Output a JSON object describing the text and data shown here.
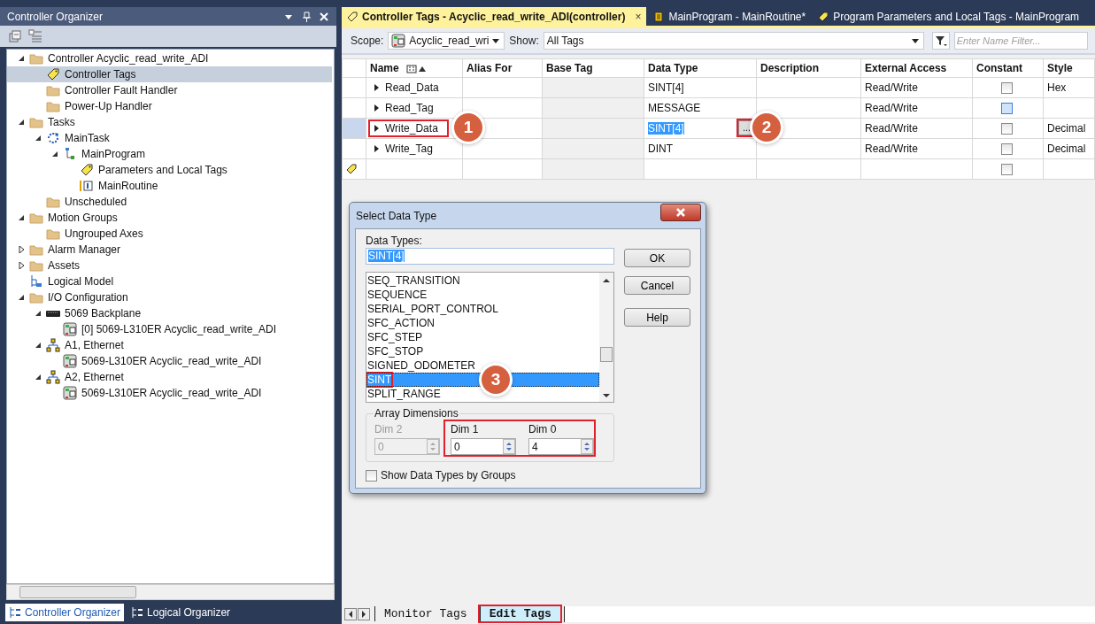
{
  "organizer": {
    "title": "Controller Organizer",
    "tree": [
      {
        "label": "Controller Acyclic_read_write_ADI",
        "kind": "folder",
        "expanded": true,
        "selected": false,
        "children": [
          {
            "label": "Controller Tags",
            "kind": "tags",
            "selected": true
          },
          {
            "label": "Controller Fault Handler",
            "kind": "folder",
            "selected": false
          },
          {
            "label": "Power-Up Handler",
            "kind": "folder",
            "selected": false
          }
        ]
      },
      {
        "label": "Tasks",
        "kind": "folder",
        "expanded": true,
        "selected": false,
        "children": [
          {
            "label": "MainTask",
            "kind": "task",
            "expanded": true,
            "selected": false,
            "children": [
              {
                "label": "MainProgram",
                "kind": "program",
                "expanded": true,
                "selected": false,
                "children": [
                  {
                    "label": "Parameters and Local Tags",
                    "kind": "tags",
                    "selected": false
                  },
                  {
                    "label": "MainRoutine",
                    "kind": "routine",
                    "selected": false
                  }
                ]
              }
            ]
          },
          {
            "label": "Unscheduled",
            "kind": "folder",
            "selected": false
          }
        ]
      },
      {
        "label": "Motion Groups",
        "kind": "folder",
        "expanded": true,
        "selected": false,
        "children": [
          {
            "label": "Ungrouped Axes",
            "kind": "folder",
            "selected": false
          }
        ]
      },
      {
        "label": "Alarm Manager",
        "kind": "folder",
        "expanded": false,
        "selected": false
      },
      {
        "label": "Assets",
        "kind": "folder",
        "expanded": false,
        "selected": false
      },
      {
        "label": "Logical Model",
        "kind": "model",
        "selected": false
      },
      {
        "label": "I/O Configuration",
        "kind": "folder",
        "expanded": true,
        "selected": false,
        "children": [
          {
            "label": "5069 Backplane",
            "kind": "backplane",
            "expanded": true,
            "selected": false,
            "children": [
              {
                "label": "[0] 5069-L310ER Acyclic_read_write_ADI",
                "kind": "module",
                "selected": false
              }
            ]
          },
          {
            "label": "A1, Ethernet",
            "kind": "network",
            "expanded": true,
            "selected": false,
            "children": [
              {
                "label": "5069-L310ER Acyclic_read_write_ADI",
                "kind": "module",
                "selected": false
              }
            ]
          },
          {
            "label": "A2, Ethernet",
            "kind": "network",
            "expanded": true,
            "selected": false,
            "children": [
              {
                "label": "5069-L310ER Acyclic_read_write_ADI",
                "kind": "module",
                "selected": false
              }
            ]
          }
        ]
      }
    ],
    "bottom_tabs": [
      {
        "label": "Controller Organizer",
        "selected": true
      },
      {
        "label": "Logical Organizer",
        "selected": false
      }
    ]
  },
  "doc_tabs": [
    {
      "label": "Controller Tags - Acyclic_read_write_ADI(controller)",
      "kind": "tags",
      "selected": true,
      "close": "×"
    },
    {
      "label": "MainProgram - MainRoutine*",
      "kind": "routine",
      "selected": false
    },
    {
      "label": "Program Parameters and Local Tags - MainProgram",
      "kind": "tags",
      "selected": false
    }
  ],
  "toolbar": {
    "scope_label": "Scope:",
    "scope": "Acyclic_read_wri",
    "show_label": "Show:",
    "show": "All Tags",
    "filter_placeholder": "Enter Name Filter..."
  },
  "tags": {
    "columns": [
      "Name",
      "Alias For",
      "Base Tag",
      "Data Type",
      "Description",
      "External Access",
      "Constant",
      "Style"
    ],
    "rows": [
      {
        "kind": "tag",
        "name": "Read_Data",
        "data_type": "SINT[4]",
        "external_access": "Read/Write",
        "constant": false,
        "style": "Hex",
        "selected": false
      },
      {
        "kind": "tag",
        "name": "Read_Tag",
        "data_type": "MESSAGE",
        "external_access": "Read/Write",
        "constant": false,
        "constant_focused": true,
        "selected": false
      },
      {
        "kind": "tag",
        "name": "Write_Data",
        "data_type": "SINT[4]",
        "external_access": "Read/Write",
        "constant": false,
        "style": "Decimal",
        "selected": true,
        "name_highlighted": true,
        "name_callout": "1",
        "type_editing": true,
        "browse_label": "...",
        "browse_callout": "2"
      },
      {
        "kind": "tag",
        "name": "Write_Tag",
        "data_type": "DINT",
        "external_access": "Read/Write",
        "constant": false,
        "style": "Decimal",
        "selected": false
      },
      {
        "kind": "new",
        "constant": false,
        "selected": false
      }
    ]
  },
  "view_tabs": [
    {
      "label": "Monitor Tags",
      "selected": false,
      "highlighted": false
    },
    {
      "label": "Edit Tags",
      "selected": true,
      "highlighted": true
    }
  ],
  "dialog": {
    "title": "Select Data Type",
    "types_label": "Data Types:",
    "types_value": "SINT[4]",
    "list": [
      {
        "label": "SEQ_TRANSITION",
        "selected": false
      },
      {
        "label": "SEQUENCE",
        "selected": false
      },
      {
        "label": "SERIAL_PORT_CONTROL",
        "selected": false
      },
      {
        "label": "SFC_ACTION",
        "selected": false
      },
      {
        "label": "SFC_STEP",
        "selected": false
      },
      {
        "label": "SFC_STOP",
        "selected": false
      },
      {
        "label": "SIGNED_ODOMETER",
        "selected": false
      },
      {
        "label": "SINT",
        "selected": true,
        "highlighted": true,
        "callout": "3"
      },
      {
        "label": "SPLIT_RANGE",
        "selected": false
      }
    ],
    "buttons": [
      "OK",
      "Cancel",
      "Help"
    ],
    "dimensions": {
      "title": "Array Dimensions",
      "items": [
        {
          "label": "Dim 2",
          "value": "0",
          "disabled": true
        },
        {
          "label": "Dim 1",
          "value": "0",
          "disabled": false,
          "highlighted": true
        },
        {
          "label": "Dim 0",
          "value": "4",
          "disabled": false,
          "highlighted": true
        }
      ]
    },
    "group_checkbox": {
      "label": "Show Data Types by Groups",
      "checked": false
    }
  }
}
